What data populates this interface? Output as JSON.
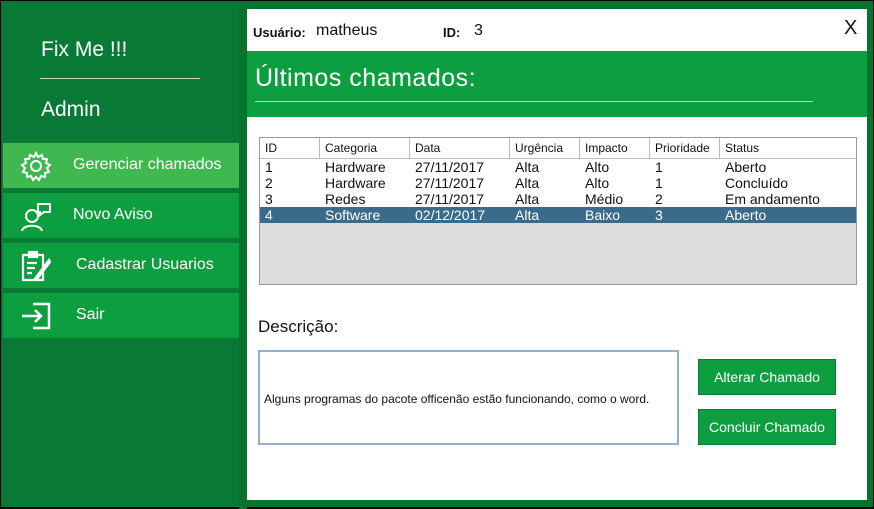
{
  "sidebar": {
    "app_name": "Fix Me !!!",
    "role": "Admin",
    "items": [
      {
        "label": "Gerenciar chamados",
        "icon": "gear-icon"
      },
      {
        "label": "Novo Aviso",
        "icon": "user-chat-icon"
      },
      {
        "label": "Cadastrar Usuarios",
        "icon": "clipboard-edit-icon"
      },
      {
        "label": "Sair",
        "icon": "exit-icon"
      }
    ]
  },
  "topbar": {
    "user_label": "Usuário:",
    "user_value": "matheus",
    "id_label": "ID:",
    "id_value": "3",
    "close": "X"
  },
  "header": {
    "title": "Últimos  chamados:"
  },
  "table": {
    "columns": [
      "ID",
      "Categoria",
      "Data",
      "Urgência",
      "Impacto",
      "Prioridade",
      "Status"
    ],
    "rows": [
      [
        "1",
        "Hardware",
        "27/11/2017",
        "Alta",
        "Alto",
        "1",
        "Aberto"
      ],
      [
        "2",
        "Hardware",
        "27/11/2017",
        "Alta",
        "Alto",
        "1",
        "Concluído"
      ],
      [
        "3",
        "Redes",
        "27/11/2017",
        "Alta",
        "Médio",
        "2",
        "Em andamento"
      ],
      [
        "4",
        "Software",
        "02/12/2017",
        "Alta",
        "Baixo",
        "3",
        "Aberto"
      ]
    ],
    "selected_row": 3
  },
  "description": {
    "label": "Descrição:",
    "text": "Alguns programas do pacote officenão estão funcionando, como o word."
  },
  "buttons": {
    "alter": "Alterar Chamado",
    "conclude": "Concluir Chamado"
  },
  "colors": {
    "green": "#0d9f3f",
    "active_green": "#3fb84f",
    "dark_green": "#087a36",
    "selection": "#3b6b8b"
  }
}
